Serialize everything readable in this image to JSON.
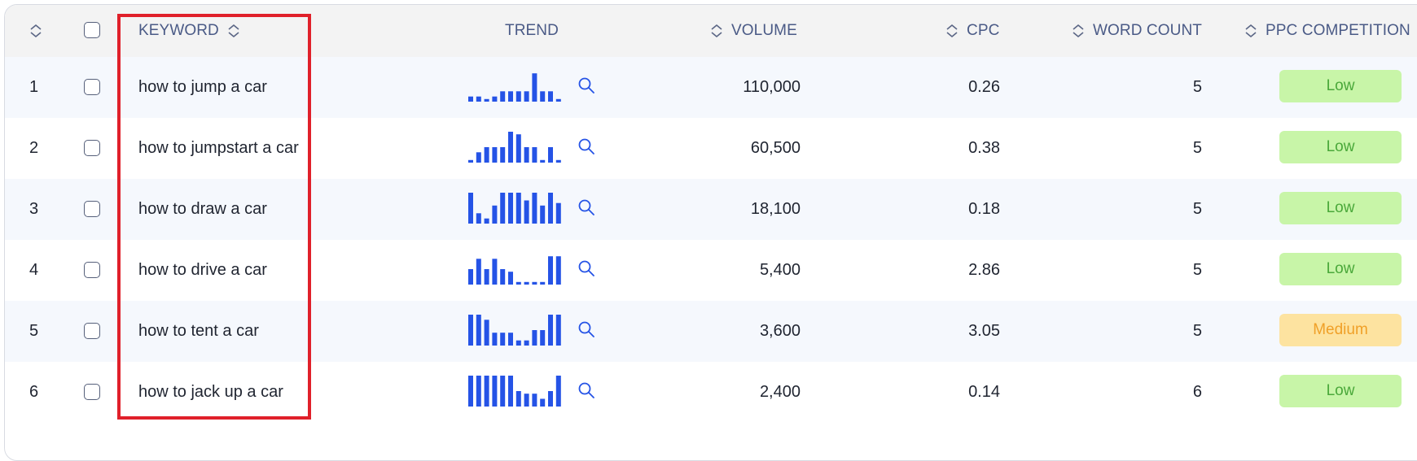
{
  "columns": {
    "keyword": "KEYWORD",
    "trend": "TREND",
    "volume": "VOLUME",
    "cpc": "CPC",
    "word_count": "WORD COUNT",
    "ppc_competition": "PPC COMPETITION"
  },
  "rows": [
    {
      "index": "1",
      "keyword": "how to jump a car",
      "trend": [
        2,
        2,
        1,
        2,
        4,
        4,
        4,
        4,
        11,
        4,
        4,
        1
      ],
      "volume": "110,000",
      "cpc": "0.26",
      "word_count": "5",
      "competition": "Low",
      "competition_level": "low"
    },
    {
      "index": "2",
      "keyword": "how to jumpstart a car",
      "trend": [
        1,
        4,
        6,
        6,
        6,
        12,
        11,
        6,
        6,
        1,
        6,
        1
      ],
      "volume": "60,500",
      "cpc": "0.38",
      "word_count": "5",
      "competition": "Low",
      "competition_level": "low"
    },
    {
      "index": "3",
      "keyword": "how to draw a car",
      "trend": [
        12,
        4,
        2,
        7,
        12,
        12,
        12,
        9,
        12,
        7,
        12,
        8
      ],
      "volume": "18,100",
      "cpc": "0.18",
      "word_count": "5",
      "competition": "Low",
      "competition_level": "low"
    },
    {
      "index": "4",
      "keyword": "how to drive a car",
      "trend": [
        6,
        10,
        6,
        10,
        6,
        5,
        1,
        1,
        1,
        1,
        11,
        11
      ],
      "volume": "5,400",
      "cpc": "2.86",
      "word_count": "5",
      "competition": "Low",
      "competition_level": "low"
    },
    {
      "index": "5",
      "keyword": "how to tent a car",
      "trend": [
        12,
        12,
        10,
        5,
        5,
        5,
        2,
        2,
        6,
        6,
        12,
        12
      ],
      "volume": "3,600",
      "cpc": "3.05",
      "word_count": "5",
      "competition": "Medium",
      "competition_level": "medium"
    },
    {
      "index": "6",
      "keyword": "how to jack up a car",
      "trend": [
        12,
        12,
        12,
        12,
        12,
        12,
        6,
        5,
        5,
        3,
        6,
        12
      ],
      "volume": "2,400",
      "cpc": "0.14",
      "word_count": "6",
      "competition": "Low",
      "competition_level": "low"
    }
  ],
  "colors": {
    "trend_bar": "#2553e6",
    "highlight": "#e0202a",
    "low_bg": "#c8f5a8",
    "low_text": "#4aa83a",
    "medium_bg": "#fde3a0",
    "medium_text": "#f0a028"
  },
  "icons": {
    "sort": "sort-updown-icon",
    "trend_search": "magnifier-icon"
  }
}
